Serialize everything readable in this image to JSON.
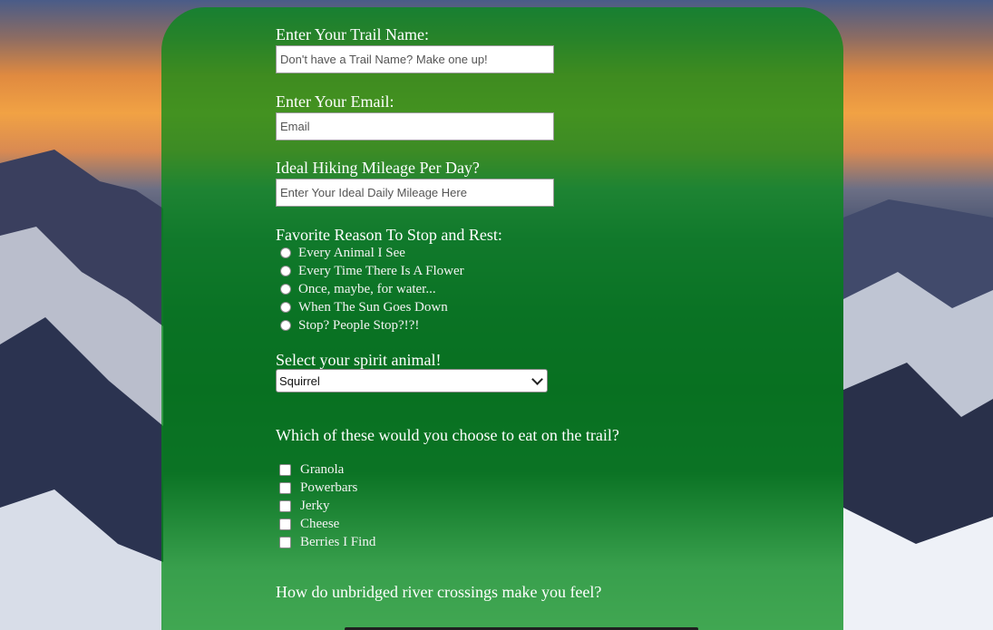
{
  "form": {
    "trail_name": {
      "label": "Enter Your Trail Name:",
      "placeholder": "Don't have a Trail Name? Make one up!"
    },
    "email": {
      "label": "Enter Your Email:",
      "placeholder": "Email"
    },
    "mileage": {
      "label": "Ideal Hiking Mileage Per Day?",
      "placeholder": "Enter Your Ideal Daily Mileage Here"
    },
    "rest_reason": {
      "label": "Favorite Reason To Stop and Rest:",
      "options": [
        "Every Animal I See",
        "Every Time There Is A Flower",
        "Once, maybe, for water...",
        "When The Sun Goes Down",
        "Stop? People Stop?!?!"
      ]
    },
    "spirit_animal": {
      "label": "Select your spirit animal!",
      "selected": "Squirrel"
    },
    "trail_food": {
      "label": "Which of these would you choose to eat on the trail?",
      "options": [
        "Granola",
        "Powerbars",
        "Jerky",
        "Cheese",
        "Berries I Find"
      ]
    },
    "river_crossing": {
      "label": "How do unbridged river crossings make you feel?"
    }
  },
  "colors": {
    "panel": "#008c14",
    "text": "#ffffff"
  }
}
